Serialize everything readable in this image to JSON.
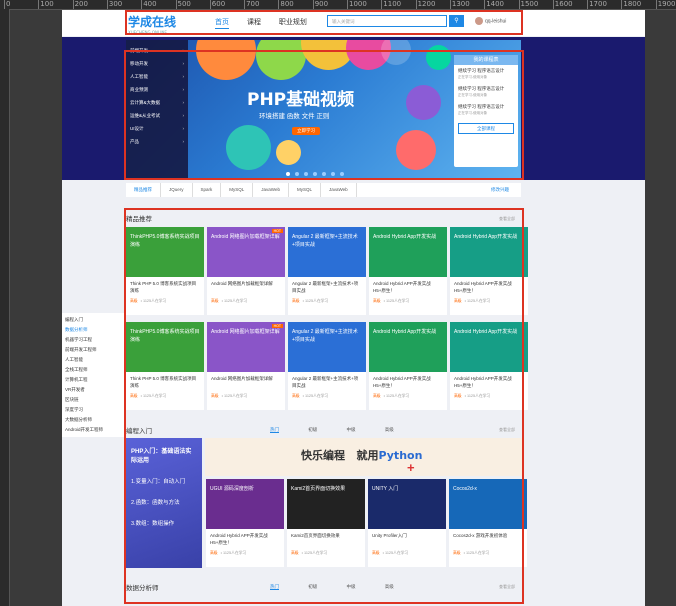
{
  "ruler": {
    "labels": [
      "0",
      "100",
      "200",
      "300",
      "400",
      "500",
      "600",
      "700",
      "800",
      "900",
      "1000",
      "1100",
      "1200",
      "1300",
      "1400",
      "1500",
      "1600",
      "1700",
      "1800",
      "1900"
    ]
  },
  "header": {
    "logo": "学成在线",
    "logo_sub": "XUECHENG ONLINE",
    "nav": [
      "首页",
      "课程",
      "职业规划"
    ],
    "search_placeholder": "输入关键词",
    "search_icon": "search-icon",
    "username": "qq-leishui"
  },
  "banner": {
    "categories": [
      "前端开发",
      "移动开发",
      "人工智能",
      "商业预测",
      "云计算&大数据",
      "运维&从业考试",
      "UI设计",
      "产品"
    ],
    "title": "PHP基础视频",
    "subtitle": "环境搭建  函数  文件  正则",
    "button": "立即学习",
    "dots": 7,
    "panel": {
      "title": "我的课程表",
      "items": [
        {
          "title": "继续学习 程序语言设计",
          "sub": "正在学习-使用对象"
        },
        {
          "title": "继续学习 程序语言设计",
          "sub": "正在学习-使用对象"
        },
        {
          "title": "继续学习 程序语言设计",
          "sub": "正在学习-使用对象"
        }
      ],
      "button": "全部课程"
    }
  },
  "subnav": {
    "items": [
      "精品推荐",
      "JQuery",
      "Spark",
      "MySQL",
      "JavaWeb",
      "MySQL",
      "JavaWeb"
    ],
    "more": "修改兴趣"
  },
  "left_nav": [
    "编程入门",
    "数据分析师",
    "机器学习工程",
    "前端开发工程师",
    "人工智能",
    "全栈工程师",
    "计算机工程",
    "VR开发者",
    "区块链",
    "深度学习",
    "大数据分析师",
    "Android开发工程师"
  ],
  "featured": {
    "title": "精品推荐",
    "more": "查看全部",
    "cards": [
      {
        "thumb": "ThinkPHP5.0博客系统实战项目演练",
        "caption": "Think PHP 5.0 博客系统实战项目演练",
        "level": "高级",
        "learners": "1125人在学习",
        "bg": "#3aa03a"
      },
      {
        "thumb": "Android 网络图片加载框架详解",
        "caption": "Android 网络图片加载框架详解",
        "level": "高级",
        "learners": "1125人在学习",
        "bg": "#8a55c8",
        "hot": "HOT"
      },
      {
        "thumb": "Angular 2 最新框架+主流技术+项目实战",
        "caption": "Angular 2 最新框架+主流技术+项目实战",
        "level": "高级",
        "learners": "1125人在学习",
        "bg": "#2b6fd6"
      },
      {
        "thumb": "Android Hybrid App开发实战",
        "caption": "Android Hybrid APP开发实战 H5+原生！",
        "level": "高级",
        "learners": "1125人在学习",
        "bg": "#1fa05a"
      },
      {
        "thumb": "Android Hybrid App开发实战",
        "caption": "Android Hybrid APP开发实战 H5+原生！",
        "level": "高级",
        "learners": "1125人在学习",
        "bg": "#169e86"
      },
      {
        "thumb": "ThinkPHP5.0博客系统实战项目演练",
        "caption": "Think PHP 5.0 博客系统实战项目演练",
        "level": "高级",
        "learners": "1125人在学习",
        "bg": "#3aa03a"
      },
      {
        "thumb": "Android 网络图片加载框架详解",
        "caption": "Android 网络图片加载框架详解",
        "level": "高级",
        "learners": "1125人在学习",
        "bg": "#8a55c8",
        "hot": "HOT"
      },
      {
        "thumb": "Angular 2 最新框架+主流技术+项目实战",
        "caption": "Angular 2 最新框架+主流技术+项目实战",
        "level": "高级",
        "learners": "1125人在学习",
        "bg": "#2b6fd6"
      },
      {
        "thumb": "Android Hybrid App开发实战",
        "caption": "Android Hybrid APP开发实战 H5+原生！",
        "level": "高级",
        "learners": "1125人在学习",
        "bg": "#1fa05a"
      },
      {
        "thumb": "Android Hybrid App开发实战",
        "caption": "Android Hybrid APP开发实战 H5+原生！",
        "level": "高级",
        "learners": "1125人在学习",
        "bg": "#169e86"
      }
    ]
  },
  "intro": {
    "title": "编程入门",
    "tabs": [
      "热门",
      "初级",
      "中级",
      "高级"
    ],
    "more": "查看全部",
    "bigcard": [
      "PHP入门：基础语法实际运用",
      "1.变量入门：自动入门",
      "2.函数：函数与方法",
      "3.数组：数组操作"
    ],
    "promo": {
      "text1": "快乐编程",
      "text2": "就用",
      "text3": "Python",
      "plus": "+"
    },
    "cards": [
      {
        "thumb": "UGUI 源码深度剖析",
        "caption": "Android Hybrid APP开发实战 H5+原生！",
        "level": "高级",
        "learners": "1125人在学习",
        "bg": "#6a2d8f"
      },
      {
        "thumb": "Kami2首页界面切换效果",
        "caption": "Kami2首页界面切换效果",
        "level": "高级",
        "learners": "1125人在学习",
        "bg": "#222"
      },
      {
        "thumb": "UNITY 入门",
        "caption": "Unity Profiler入门",
        "level": "高级",
        "learners": "1125人在学习",
        "bg": "#1a2a6a"
      },
      {
        "thumb": "Cocos2d-x",
        "caption": "Cocos2d-x 游戏开发初体验",
        "level": "高级",
        "learners": "1125人在学习",
        "bg": "#1668b8"
      }
    ]
  },
  "data_section": {
    "title": "数据分析师",
    "tabs": [
      "热门",
      "初级",
      "中级",
      "高级"
    ],
    "more": "查看全部"
  }
}
